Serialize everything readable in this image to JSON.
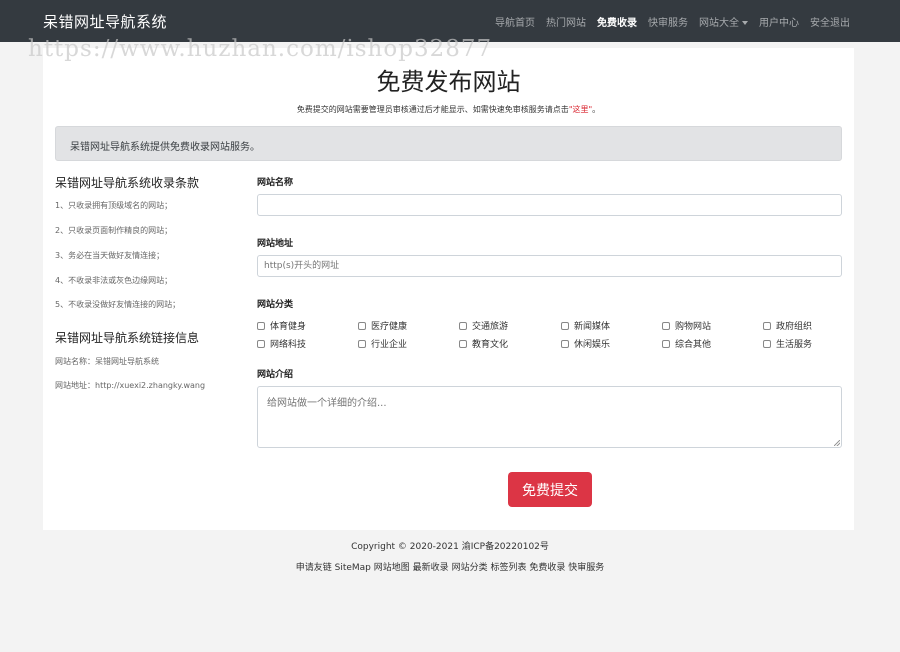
{
  "navbar": {
    "brand": "呆错网址导航系统",
    "items": [
      {
        "label": "导航首页"
      },
      {
        "label": "热门网站"
      },
      {
        "label": "免费收录"
      },
      {
        "label": "快审服务"
      },
      {
        "label": "网站大全"
      },
      {
        "label": "用户中心"
      },
      {
        "label": "安全退出"
      }
    ]
  },
  "watermark": "https://www.huzhan.com/ishop32877",
  "header": {
    "title": "免费发布网站",
    "subtitle": "免费提交的网站需要管理员审核通过后才能显示、如需快速免审核服务请点击",
    "subtitle_link": "\"这里\"",
    "subtitle_end": "。"
  },
  "alert": "呆错网址导航系统提供免费收录网站服务。",
  "sidebar": {
    "terms_title": "呆错网址导航系统收录条款",
    "terms": [
      "1、只收录拥有顶级域名的网站；",
      "2、只收录页面制作精良的网站；",
      "3、务必在当天做好友情连接；",
      "4、不收录非法或灰色边缘网站；",
      "5、不收录没做好友情连接的网站；"
    ],
    "link_title": "呆错网址导航系统链接信息",
    "link_name": "网站名称：呆错网址导航系统",
    "link_url": "网站地址：http://xuexi2.zhangky.wang"
  },
  "form": {
    "name_label": "网站名称",
    "name_value": "",
    "url_label": "网站地址",
    "url_placeholder": "http(s)开头的网址",
    "category_label": "网站分类",
    "categories": [
      "体育健身",
      "医疗健康",
      "交通旅游",
      "新闻媒体",
      "购物网站",
      "政府组织",
      "网络科技",
      "行业企业",
      "教育文化",
      "休闲娱乐",
      "综合其他",
      "生活服务"
    ],
    "intro_label": "网站介绍",
    "intro_placeholder": "给网站做一个详细的介绍...",
    "submit_label": "免费提交"
  },
  "footer": {
    "copyright": "Copyright © 2020-2021",
    "icp": "渝ICP备20220102号",
    "links": [
      "申请友链",
      "SiteMap",
      "网站地图",
      "最新收录",
      "网站分类",
      "标签列表",
      "免费收录",
      "快审服务"
    ]
  },
  "colors": {
    "navbar_bg": "#343a40",
    "accent_red": "#dc3545",
    "alert_bg": "#e2e3e5"
  }
}
